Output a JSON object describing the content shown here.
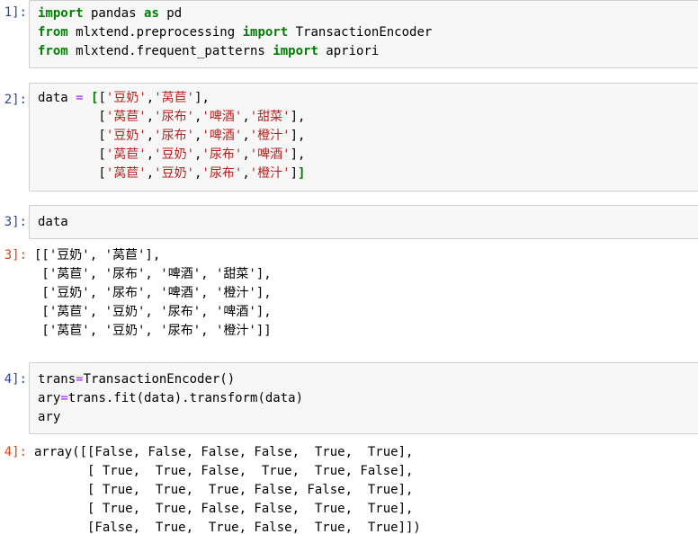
{
  "cells": [
    {
      "in_prompt": "1]:",
      "lines": [
        [
          {
            "t": "kw",
            "v": "import"
          },
          {
            "t": "p",
            "v": " pandas "
          },
          {
            "t": "kw",
            "v": "as"
          },
          {
            "t": "p",
            "v": " pd"
          }
        ],
        [
          {
            "t": "kw",
            "v": "from"
          },
          {
            "t": "p",
            "v": " mlxtend.preprocessing "
          },
          {
            "t": "kw",
            "v": "import"
          },
          {
            "t": "p",
            "v": " TransactionEncoder"
          }
        ],
        [
          {
            "t": "kw",
            "v": "from"
          },
          {
            "t": "p",
            "v": " mlxtend.frequent_patterns "
          },
          {
            "t": "kw",
            "v": "import"
          },
          {
            "t": "p",
            "v": " apriori"
          }
        ]
      ]
    },
    {
      "in_prompt": "2]:",
      "lines": [
        [
          {
            "t": "p",
            "v": "data "
          },
          {
            "t": "op",
            "v": "="
          },
          {
            "t": "p",
            "v": " "
          },
          {
            "t": "bm",
            "v": "["
          },
          {
            "t": "p",
            "v": "["
          },
          {
            "t": "str",
            "v": "'豆奶'"
          },
          {
            "t": "p",
            "v": ","
          },
          {
            "t": "str",
            "v": "'莴苣'"
          },
          {
            "t": "p",
            "v": "],"
          }
        ],
        [
          {
            "t": "p",
            "v": "        ["
          },
          {
            "t": "str",
            "v": "'莴苣'"
          },
          {
            "t": "p",
            "v": ","
          },
          {
            "t": "str",
            "v": "'尿布'"
          },
          {
            "t": "p",
            "v": ","
          },
          {
            "t": "str",
            "v": "'啤酒'"
          },
          {
            "t": "p",
            "v": ","
          },
          {
            "t": "str",
            "v": "'甜菜'"
          },
          {
            "t": "p",
            "v": "],"
          }
        ],
        [
          {
            "t": "p",
            "v": "        ["
          },
          {
            "t": "str",
            "v": "'豆奶'"
          },
          {
            "t": "p",
            "v": ","
          },
          {
            "t": "str",
            "v": "'尿布'"
          },
          {
            "t": "p",
            "v": ","
          },
          {
            "t": "str",
            "v": "'啤酒'"
          },
          {
            "t": "p",
            "v": ","
          },
          {
            "t": "str",
            "v": "'橙汁'"
          },
          {
            "t": "p",
            "v": "],"
          }
        ],
        [
          {
            "t": "p",
            "v": "        ["
          },
          {
            "t": "str",
            "v": "'莴苣'"
          },
          {
            "t": "p",
            "v": ","
          },
          {
            "t": "str",
            "v": "'豆奶'"
          },
          {
            "t": "p",
            "v": ","
          },
          {
            "t": "str",
            "v": "'尿布'"
          },
          {
            "t": "p",
            "v": ","
          },
          {
            "t": "str",
            "v": "'啤酒'"
          },
          {
            "t": "p",
            "v": "],"
          }
        ],
        [
          {
            "t": "p",
            "v": "        ["
          },
          {
            "t": "str",
            "v": "'莴苣'"
          },
          {
            "t": "p",
            "v": ","
          },
          {
            "t": "str",
            "v": "'豆奶'"
          },
          {
            "t": "p",
            "v": ","
          },
          {
            "t": "str",
            "v": "'尿布'"
          },
          {
            "t": "p",
            "v": ","
          },
          {
            "t": "str",
            "v": "'橙汁'"
          },
          {
            "t": "p",
            "v": "]"
          },
          {
            "t": "bm",
            "v": "]"
          }
        ]
      ]
    },
    {
      "in_prompt": "3]:",
      "lines": [
        [
          {
            "t": "p",
            "v": "data"
          }
        ]
      ],
      "out_prompt": "3]:",
      "output": "[['豆奶', '莴苣'],\n ['莴苣', '尿布', '啤酒', '甜菜'],\n ['豆奶', '尿布', '啤酒', '橙汁'],\n ['莴苣', '豆奶', '尿布', '啤酒'],\n ['莴苣', '豆奶', '尿布', '橙汁']]"
    },
    {
      "in_prompt": "4]:",
      "lines": [
        [
          {
            "t": "p",
            "v": "trans"
          },
          {
            "t": "op",
            "v": "="
          },
          {
            "t": "p",
            "v": "TransactionEncoder()"
          }
        ],
        [
          {
            "t": "p",
            "v": "ary"
          },
          {
            "t": "op",
            "v": "="
          },
          {
            "t": "p",
            "v": "trans.fit(data).transform(data)"
          }
        ],
        [
          {
            "t": "p",
            "v": "ary"
          }
        ]
      ],
      "out_prompt": "4]:",
      "output": "array([[False, False, False, False,  True,  True],\n       [ True,  True, False,  True,  True, False],\n       [ True,  True,  True, False, False,  True],\n       [ True,  True, False, False,  True,  True],\n       [False,  True,  True, False,  True,  True]])"
    }
  ]
}
